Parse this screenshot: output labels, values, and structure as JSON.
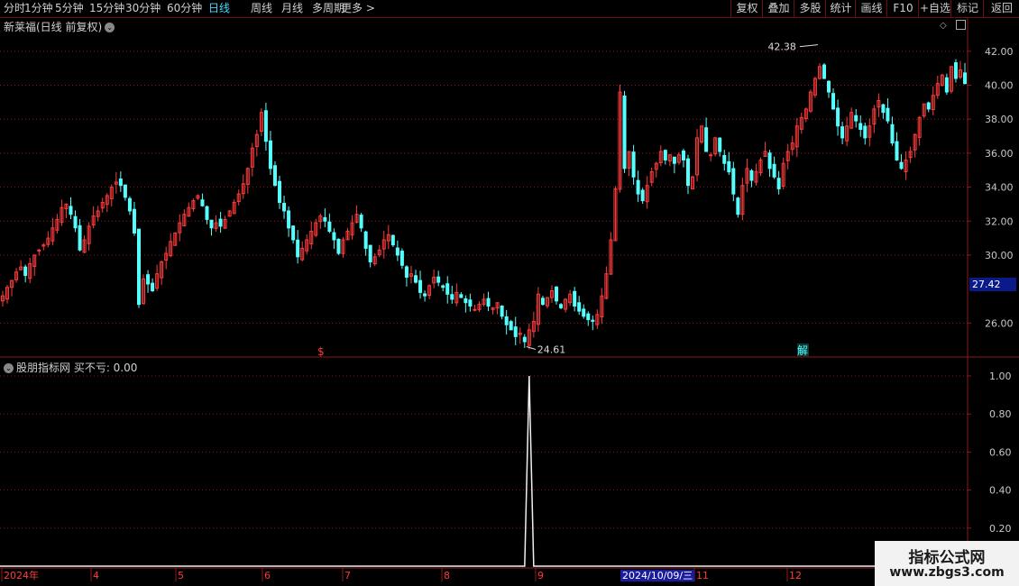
{
  "toolbar": {
    "periods": [
      "分时",
      "1分钟",
      "5分钟",
      "15分钟",
      "30分钟",
      "60分钟",
      "日线",
      "周线",
      "月线",
      "多周期",
      "更多"
    ],
    "active_period": "日线",
    "right_buttons": [
      "复权",
      "叠加",
      "多股",
      "统计",
      "画线",
      "F10",
      "+自选",
      "标记",
      "返回"
    ]
  },
  "main_panel": {
    "title": "新莱福(日线 前复权)",
    "y_axis_labels": [
      "42.00",
      "40.00",
      "38.00",
      "36.00",
      "34.00",
      "32.00",
      "30.00",
      "26.00"
    ],
    "current_price": "27.42",
    "high_annotation": "42.38",
    "low_annotation": "24.61",
    "markers": [
      "$",
      "解"
    ]
  },
  "sub_panel": {
    "title": "股朋指标网  买不亏: 0.00",
    "y_axis_labels": [
      "1.00",
      "0.80",
      "0.60",
      "0.40",
      "0.20"
    ]
  },
  "x_axis": {
    "labels": [
      "2024年",
      "4",
      "5",
      "6",
      "7",
      "8",
      "9",
      "11",
      "12"
    ],
    "selected_date": "2024/10/09/三"
  },
  "watermark": {
    "title": "指标公式网",
    "url": "www.zbgs3.com"
  },
  "colors": {
    "up": "#ff3b3b",
    "down": "#54ffff",
    "grid": "#8a1a1a",
    "background": "#000000"
  },
  "chart_data": {
    "type": "candlestick",
    "y_range": [
      24.0,
      43.0
    ],
    "close_series": [
      27.6,
      28.1,
      28.5,
      29.0,
      29.3,
      28.8,
      29.5,
      30.0,
      30.3,
      30.6,
      31.0,
      31.6,
      32.1,
      32.8,
      33.0,
      32.4,
      31.6,
      30.3,
      30.9,
      31.7,
      32.3,
      32.6,
      33.1,
      33.5,
      34.0,
      34.3,
      34.1,
      33.4,
      32.6,
      31.3,
      27.1,
      28.6,
      28.3,
      27.9,
      28.9,
      29.6,
      30.1,
      30.8,
      31.3,
      31.9,
      32.4,
      32.8,
      33.2,
      33.5,
      32.9,
      32.1,
      31.6,
      31.9,
      31.7,
      32.1,
      32.6,
      33.1,
      33.6,
      34.2,
      35.1,
      36.3,
      37.1,
      38.4,
      36.7,
      35.1,
      34.1,
      33.1,
      32.6,
      31.6,
      30.9,
      29.9,
      30.4,
      30.9,
      31.4,
      31.9,
      32.3,
      32.0,
      31.4,
      30.9,
      30.1,
      30.9,
      31.4,
      31.9,
      32.4,
      31.6,
      30.4,
      29.6,
      29.9,
      30.3,
      30.9,
      31.2,
      30.6,
      30.0,
      29.4,
      28.7,
      28.9,
      28.4,
      27.8,
      27.6,
      28.2,
      28.7,
      28.4,
      28.1,
      27.7,
      27.4,
      27.8,
      27.5,
      27.2,
      27.0,
      26.8,
      27.1,
      27.4,
      27.0,
      26.9,
      27.2,
      26.4,
      25.9,
      25.6,
      25.2,
      25.4,
      24.9,
      25.6,
      26.1,
      27.7,
      27.1,
      27.5,
      27.9,
      27.3,
      26.9,
      27.4,
      27.7,
      27.0,
      26.7,
      26.4,
      26.2,
      26.1,
      26.5,
      27.6,
      28.9,
      30.9,
      33.9,
      39.6,
      35.1,
      36.1,
      34.6,
      33.6,
      33.2,
      34.1,
      34.9,
      35.4,
      36.1,
      35.6,
      35.9,
      35.4,
      35.9,
      35.6,
      34.1,
      34.6,
      36.9,
      37.6,
      36.1,
      35.9,
      36.9,
      36.1,
      35.4,
      34.9,
      33.6,
      32.4,
      34.1,
      35.1,
      34.4,
      34.9,
      35.6,
      36.1,
      35.1,
      34.6,
      33.9,
      35.4,
      36.1,
      36.6,
      37.6,
      38.1,
      38.6,
      39.6,
      40.4,
      41.1,
      40.4,
      39.6,
      38.6,
      37.6,
      36.9,
      37.6,
      38.4,
      37.9,
      37.4,
      36.9,
      37.6,
      38.6,
      39.1,
      38.4,
      37.9,
      36.6,
      35.6,
      35.1,
      35.6,
      36.1,
      37.1,
      38.1,
      38.9,
      38.6,
      39.4,
      40.1,
      40.6,
      39.6,
      41.1,
      40.4,
      40.9,
      40.1
    ]
  }
}
